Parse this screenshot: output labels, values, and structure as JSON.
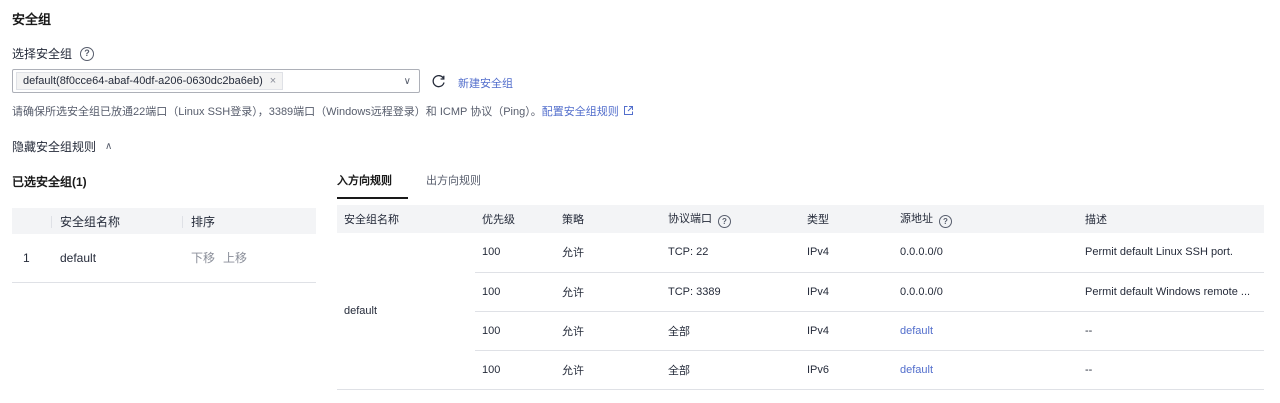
{
  "section_title": "安全组",
  "select_label": "选择安全组",
  "select": {
    "tag_value": "default(8f0cce64-abaf-40df-a206-0630dc2ba6eb)",
    "tag_close": "×",
    "chevron": "∨"
  },
  "new_group_link": "新建安全组",
  "hint": {
    "text": "请确保所选安全组已放通22端口（Linux SSH登录），3389端口（Windows远程登录）和 ICMP 协议（Ping）。",
    "link": "配置安全组规则"
  },
  "collapse_label": "隐藏安全组规则",
  "selected_title": "已选安全组(1)",
  "left_table": {
    "headers": {
      "name": "安全组名称",
      "order": "排序"
    },
    "rows": [
      {
        "index": "1",
        "name": "default",
        "move_down": "下移",
        "move_up": "上移"
      }
    ]
  },
  "tabs": [
    {
      "label": "入方向规则",
      "active": true
    },
    {
      "label": "出方向规则",
      "active": false
    }
  ],
  "rules_table": {
    "headers": {
      "group_name": "安全组名称",
      "priority": "优先级",
      "policy": "策略",
      "protocol_port": "协议端口",
      "type": "类型",
      "source": "源地址",
      "description": "描述"
    },
    "group_name": "default",
    "rows": [
      {
        "priority": "100",
        "policy": "允许",
        "protocol_port": "TCP: 22",
        "type": "IPv4",
        "source": "0.0.0.0/0",
        "description": "Permit default Linux SSH port."
      },
      {
        "priority": "100",
        "policy": "允许",
        "protocol_port": "TCP: 3389",
        "type": "IPv4",
        "source": "0.0.0.0/0",
        "description": "Permit default Windows remote ..."
      },
      {
        "priority": "100",
        "policy": "允许",
        "protocol_port": "全部",
        "type": "IPv4",
        "source": "default",
        "description": "--"
      },
      {
        "priority": "100",
        "policy": "允许",
        "protocol_port": "全部",
        "type": "IPv6",
        "source": "default",
        "description": "--"
      }
    ]
  },
  "colors": {
    "link": "#526ecc",
    "text": "#252b3a",
    "header_bg": "#f3f4f6",
    "border": "#dfe1e6"
  }
}
